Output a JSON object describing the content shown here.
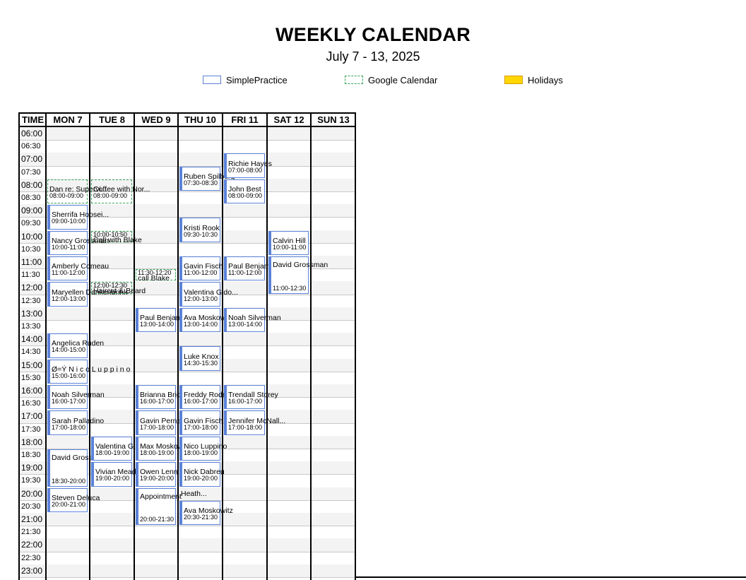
{
  "title": "WEEKLY CALENDAR",
  "subtitle": "July 7 - 13, 2025",
  "legend": {
    "simplepractice": "SimplePractice",
    "google": "Google Calendar",
    "holidays": "Holidays"
  },
  "columns": {
    "time": "TIME",
    "days": [
      "MON 7",
      "TUE 8",
      "WED 9",
      "THU 10",
      "FRI 11",
      "SAT 12",
      "SUN 13"
    ]
  },
  "times": [
    "06:00",
    "06:30",
    "07:00",
    "07:30",
    "08:00",
    "08:30",
    "09:00",
    "09:30",
    "10:00",
    "10:30",
    "11:00",
    "11:30",
    "12:00",
    "12:30",
    "13:00",
    "13:30",
    "14:00",
    "14:30",
    "15:00",
    "15:30",
    "16:00",
    "16:30",
    "17:00",
    "17:30",
    "18:00",
    "18:30",
    "19:00",
    "19:30",
    "20:00",
    "20:30",
    "21:00",
    "21:30",
    "22:00",
    "22:30",
    "23:00"
  ],
  "events": [
    {
      "day": 0,
      "name": "Dan re: Supervi...",
      "time": "08:00-09:00",
      "start": 8.0,
      "end": 9.0,
      "source": "google"
    },
    {
      "day": 0,
      "name": "Sherrifa Hoosei...",
      "time": "09:00-10:00",
      "start": 9.0,
      "end": 10.0,
      "source": "simplepractice"
    },
    {
      "day": 0,
      "name": "Nancy Grossman",
      "time": "10:00-11:00",
      "start": 10.0,
      "end": 11.0,
      "source": "simplepractice"
    },
    {
      "day": 0,
      "name": "Amberly Comeau",
      "time": "11:00-12:00",
      "start": 11.0,
      "end": 12.0,
      "source": "simplepractice"
    },
    {
      "day": 0,
      "name": "Maryellen Dankenbrink",
      "time": "12:00-13:00",
      "start": 12.0,
      "end": 13.0,
      "source": "simplepractice"
    },
    {
      "day": 0,
      "name": "Angelica Ruden",
      "time": "14:00-15:00",
      "start": 14.0,
      "end": 15.0,
      "source": "simplepractice"
    },
    {
      "day": 0,
      "name": "Ø=Ý   N i c o   L u p p i n o",
      "time": "15:00-16:00",
      "start": 15.0,
      "end": 16.0,
      "source": "simplepractice"
    },
    {
      "day": 0,
      "name": "Noah Silverman",
      "time": "16:00-17:00",
      "start": 16.0,
      "end": 17.0,
      "source": "simplepractice"
    },
    {
      "day": 0,
      "name": "Sarah Palladino",
      "time": "17:00-18:00",
      "start": 17.0,
      "end": 18.0,
      "source": "simplepractice"
    },
    {
      "day": 0,
      "name": "David Grossman",
      "time": "18:30-20:00",
      "start": 18.5,
      "end": 20.0,
      "source": "simplepractice"
    },
    {
      "day": 0,
      "name": "Steven Deluca",
      "time": "20:00-21:00",
      "start": 20.0,
      "end": 21.0,
      "source": "simplepractice"
    },
    {
      "day": 1,
      "name": "Coffee with Nor...",
      "time": "08:00-09:00",
      "start": 8.0,
      "end": 9.0,
      "source": "google"
    },
    {
      "day": 1,
      "name": "Call with Blake",
      "time": "10:00-10:50",
      "start": 10.0,
      "end": 10.5,
      "source": "google",
      "time_above": true
    },
    {
      "day": 1,
      "name": "Haircut & Beard",
      "time": "12:00-12:30",
      "start": 12.0,
      "end": 12.5,
      "source": "google",
      "time_above": true
    },
    {
      "day": 1,
      "name": "Valentina Gi",
      "time": "18:00-19:00",
      "start": 18.0,
      "end": 19.0,
      "source": "simplepractice"
    },
    {
      "day": 1,
      "name": "Vivian Meade",
      "time": "19:00-20:00",
      "start": 19.0,
      "end": 20.0,
      "source": "simplepractice"
    },
    {
      "day": 2,
      "name": "call Blake",
      "time": "11:30-12:20",
      "start": 11.5,
      "end": 12.0,
      "source": "google",
      "time_above": true
    },
    {
      "day": 2,
      "name": "Paul Benjamin",
      "time": "13:00-14:00",
      "start": 13.0,
      "end": 14.0,
      "source": "simplepractice"
    },
    {
      "day": 2,
      "name": "Brianna Brickman",
      "time": "16:00-17:00",
      "start": 16.0,
      "end": 17.0,
      "source": "simplepractice"
    },
    {
      "day": 2,
      "name": "Gavin Perna",
      "time": "17:00-18:00",
      "start": 17.0,
      "end": 18.0,
      "source": "simplepractice"
    },
    {
      "day": 2,
      "name": "Max Moskowitz",
      "time": "18:00-19:00",
      "start": 18.0,
      "end": 19.0,
      "source": "simplepractice"
    },
    {
      "day": 2,
      "name": "Owen Lenn",
      "time": "19:00-20:00",
      "start": 19.0,
      "end": 20.0,
      "source": "simplepractice"
    },
    {
      "day": 2,
      "name": "Appointment",
      "time": "20:00-21:30",
      "start": 20.0,
      "end": 21.5,
      "source": "simplepractice"
    },
    {
      "day": 3,
      "name": "Ruben Spilberg",
      "time": "07:30-08:30",
      "start": 7.5,
      "end": 8.5,
      "source": "simplepractice"
    },
    {
      "day": 3,
      "name": "Kristi Rook",
      "time": "09:30-10:30",
      "start": 9.5,
      "end": 10.5,
      "source": "simplepractice"
    },
    {
      "day": 3,
      "name": "Gavin Fisch",
      "time": "11:00-12:00",
      "start": 11.0,
      "end": 12.0,
      "source": "simplepractice"
    },
    {
      "day": 3,
      "name": "Valentina Gido...",
      "time": "12:00-13:00",
      "start": 12.0,
      "end": 13.0,
      "source": "simplepractice"
    },
    {
      "day": 3,
      "name": "Ava Moskowitz",
      "time": "13:00-14:00",
      "start": 13.0,
      "end": 14.0,
      "source": "simplepractice"
    },
    {
      "day": 3,
      "name": "Luke Knox",
      "time": "14:30-15:30",
      "start": 14.5,
      "end": 15.5,
      "source": "simplepractice"
    },
    {
      "day": 3,
      "name": "Freddy Rodriguez",
      "time": "16:00-17:00",
      "start": 16.0,
      "end": 17.0,
      "source": "simplepractice"
    },
    {
      "day": 3,
      "name": "Gavin Fisch",
      "time": "17:00-18:00",
      "start": 17.0,
      "end": 18.0,
      "source": "simplepractice"
    },
    {
      "day": 3,
      "name": "Nico Luppino",
      "time": "18:00-19:00",
      "start": 18.0,
      "end": 19.0,
      "source": "simplepractice"
    },
    {
      "day": 3,
      "name": "Nick Dabreu",
      "time": "19:00-20:00",
      "start": 19.0,
      "end": 20.0,
      "source": "simplepractice"
    },
    {
      "day": 3,
      "name": "Ava Moskowitz",
      "time": "20:30-21:30",
      "start": 20.5,
      "end": 21.5,
      "source": "simplepractice"
    },
    {
      "day": 3,
      "name": "Heath...",
      "time": "",
      "start": 20.0,
      "end": 20.5,
      "source": "simplepractice",
      "text_only": true
    },
    {
      "day": 4,
      "name": "Richie Hayes",
      "time": "07:00-08:00",
      "start": 7.0,
      "end": 8.0,
      "source": "simplepractice"
    },
    {
      "day": 4,
      "name": "John Best",
      "time": "08:00-09:00",
      "start": 8.0,
      "end": 9.0,
      "source": "simplepractice"
    },
    {
      "day": 4,
      "name": "Paul Benjamin",
      "time": "11:00-12:00",
      "start": 11.0,
      "end": 12.0,
      "source": "simplepractice"
    },
    {
      "day": 4,
      "name": "Noah Silverman",
      "time": "13:00-14:00",
      "start": 13.0,
      "end": 14.0,
      "source": "simplepractice"
    },
    {
      "day": 4,
      "name": "Trendall Storey",
      "time": "16:00-17:00",
      "start": 16.0,
      "end": 17.0,
      "source": "simplepractice"
    },
    {
      "day": 4,
      "name": "Jennifer McNall...",
      "time": "17:00-18:00",
      "start": 17.0,
      "end": 18.0,
      "source": "simplepractice"
    },
    {
      "day": 5,
      "name": "Calvin Hill",
      "time": "10:00-11:00",
      "start": 10.0,
      "end": 11.0,
      "source": "simplepractice"
    },
    {
      "day": 5,
      "name": "David Grossman",
      "time": "11:00-12:30",
      "start": 11.0,
      "end": 12.5,
      "source": "simplepractice"
    }
  ]
}
